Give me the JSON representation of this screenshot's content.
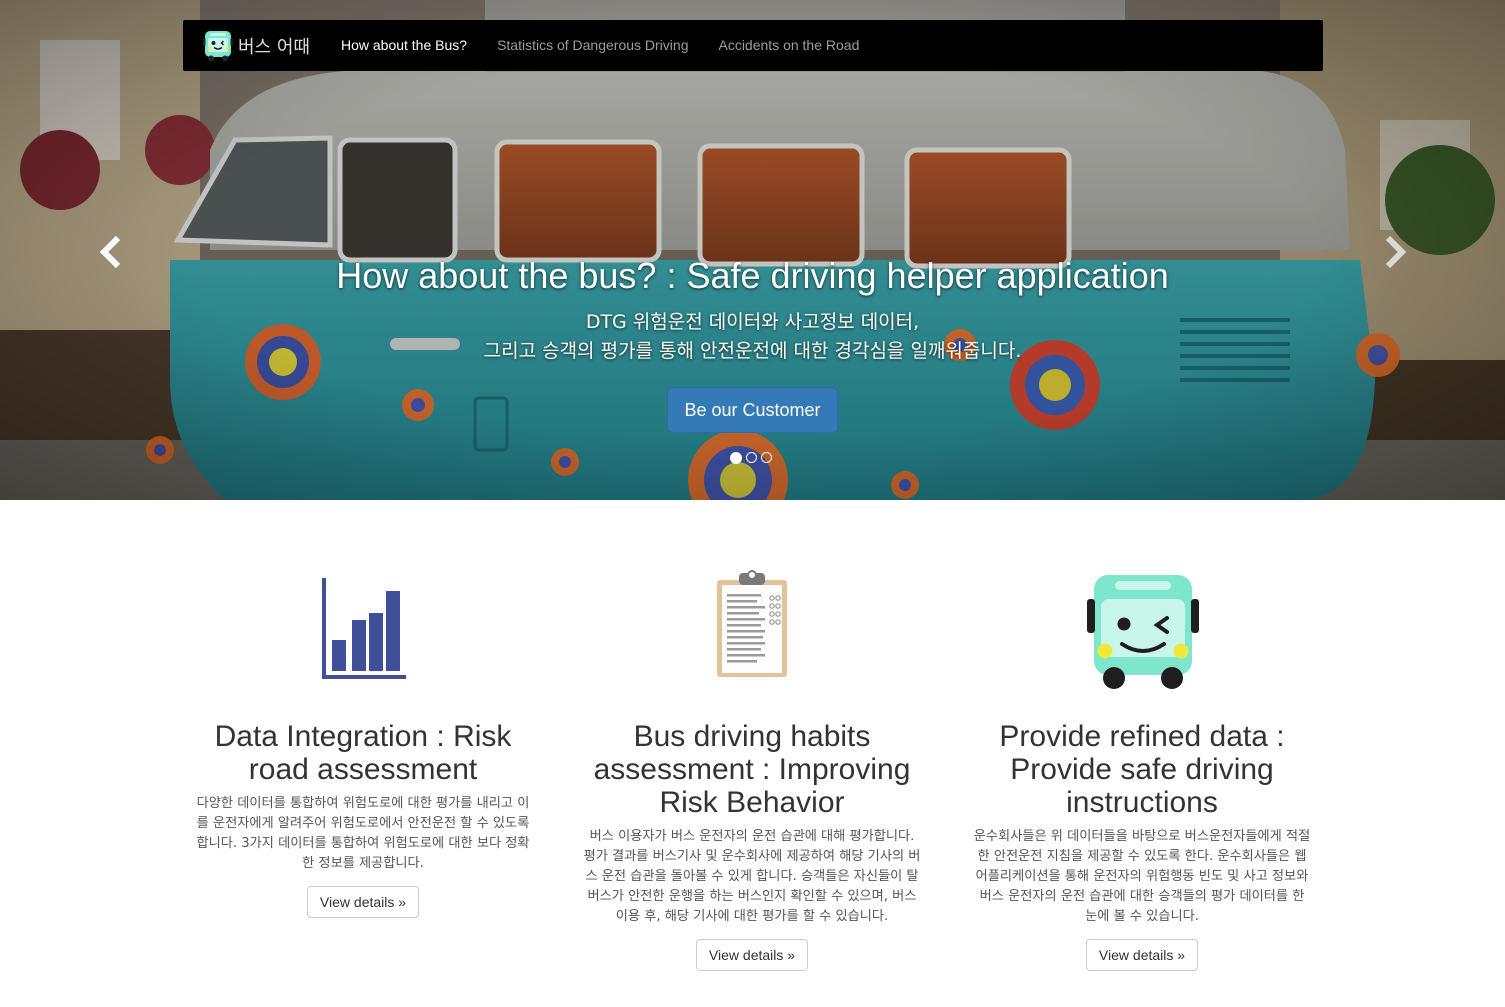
{
  "navbar": {
    "brand_text": "버스 어때",
    "items": [
      {
        "label": "How about the Bus?",
        "active": true
      },
      {
        "label": "Statistics of Dangerous Driving",
        "active": false
      },
      {
        "label": "Accidents on the Road",
        "active": false
      }
    ]
  },
  "hero": {
    "title": "How about the bus? : Safe driving helper application",
    "subtitle_line1": "DTG 위험운전 데이터와 사고정보 데이터,",
    "subtitle_line2": "그리고 승객의 평가를 통해 안전운전에 대한 경각심을 일깨워줍니다.",
    "cta_label": "Be our Customer",
    "slide_count": 3,
    "active_slide": 0
  },
  "features": [
    {
      "icon": "bar-chart-icon",
      "title": "Data Integration : Risk road assessment",
      "text": "다양한 데이터를 통합하여 위험도로에 대한 평가를 내리고 이를 운전자에게 알려주어 위험도로에서 안전운전 할 수 있도록 합니다. 3가지 데이터를 통합하여 위험도로에 대한 보다 정확한 정보를 제공합니다.",
      "button_label": "View details »"
    },
    {
      "icon": "clipboard-icon",
      "title": "Bus driving habits assessment : Improving Risk Behavior",
      "text": "버스 이용자가 버스 운전자의 운전 습관에 대해 평가합니다. 평가 결과를 버스기사 및 운수회사에 제공하여 해당 기사의 버스 운전 습관을 돌아볼 수 있게 합니다. 승객들은 자신들이 탈 버스가 안전한 운행을 하는 버스인지 확인할 수 있으며, 버스 이용 후, 해당 기사에 대한 평가를 할 수 있습니다.",
      "button_label": "View details »"
    },
    {
      "icon": "bus-mascot-icon",
      "title": "Provide refined data : Provide safe driving instructions",
      "text": "운수회사들은 위 데이터들을 바탕으로 버스운전자들에게 적절한 안전운전 지침을 제공할 수 있도록 한다. 운수회사들은 웹 어플리케이션을 통해 운전자의 위험행동 빈도 및 사고 정보와 버스 운전자의 운전 습관에 대한 승객들의 평가 데이터를 한 눈에 볼 수 있습니다.",
      "button_label": "View details »"
    }
  ],
  "colors": {
    "navbar_bg": "#000000",
    "cta_blue": "#337ab7",
    "chart_icon": "#3f4f9a",
    "mascot_teal": "#7ee6cc"
  }
}
